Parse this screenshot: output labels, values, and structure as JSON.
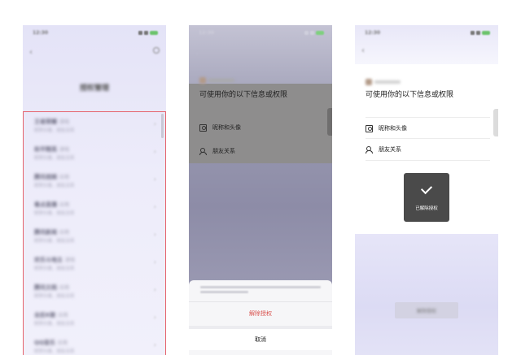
{
  "screen1": {
    "status_time": "12:30",
    "title": "授权管理",
    "items": [
      {
        "title": "王者荣耀",
        "tag": "游戏",
        "sub": "昵称头像、朋友关系"
      },
      {
        "title": "和平精英",
        "tag": "游戏",
        "sub": "昵称头像、朋友关系"
      },
      {
        "title": "腾讯视频",
        "tag": "应用",
        "sub": "昵称头像、朋友关系"
      },
      {
        "title": "看点直播",
        "tag": "应用",
        "sub": "昵称头像、朋友关系"
      },
      {
        "title": "腾讯新闻",
        "tag": "应用",
        "sub": "昵称头像、朋友关系"
      },
      {
        "title": "欢乐斗地主",
        "tag": "游戏",
        "sub": "昵称头像、朋友关系"
      },
      {
        "title": "腾讯文档",
        "tag": "应用",
        "sub": "昵称头像、朋友关系"
      },
      {
        "title": "全民K歌",
        "tag": "应用",
        "sub": "昵称头像、朋友关系"
      },
      {
        "title": "QQ音乐",
        "tag": "应用",
        "sub": "昵称头像、朋友关系"
      }
    ]
  },
  "screen2": {
    "status_time": "12:30",
    "perm_title": "可使用你的以下信息或权限",
    "perm_nickname": "昵称和头像",
    "perm_friends": "朋友关系",
    "revoke_label": "解除授权",
    "cancel_label": "取消"
  },
  "screen3": {
    "status_time": "12:30",
    "perm_title": "可使用你的以下信息或权限",
    "perm_nickname": "昵称和头像",
    "perm_friends": "朋友关系",
    "toast_message": "已解除授权",
    "bottom_button": "解除授权"
  },
  "colors": {
    "highlight_border": "#e5636d",
    "revoke_red": "#d9534f",
    "toast_bg": "#4a4a4a"
  }
}
